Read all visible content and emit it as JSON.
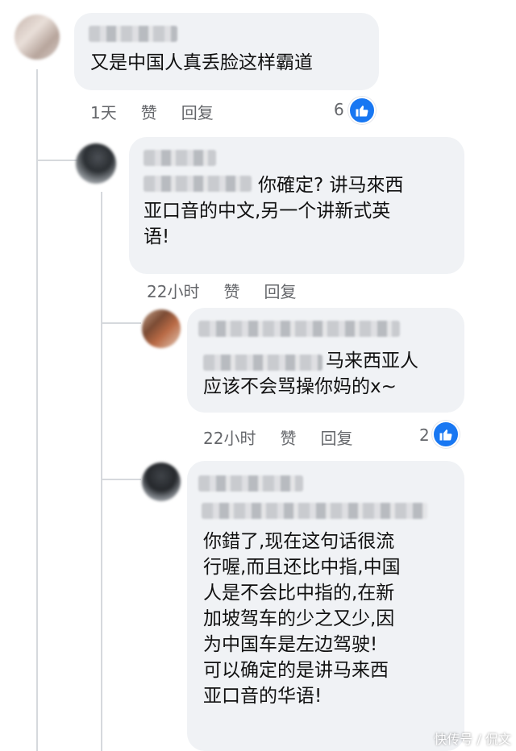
{
  "comments": [
    {
      "text": "又是中国人真丢脸这样霸道",
      "actions": {
        "time": "1天",
        "like": "赞",
        "reply": "回复"
      },
      "likes": "6"
    },
    {
      "text": "你確定? 讲马來西\n亚口音的中文,另一个讲新式英\n语!",
      "actions": {
        "time": "22小时",
        "like": "赞",
        "reply": "回复"
      }
    },
    {
      "text": "马来西亚人\n应该不会骂操你妈的x~",
      "actions": {
        "time": "22小时",
        "like": "赞",
        "reply": "回复"
      },
      "likes": "2"
    },
    {
      "text": "你錯了,现在这句话很流\n行喔,而且还比中指,中国\n人是不会比中指的,在新\n加坡驾车的少之又少,因\n为中国车是左边驾驶!\n可以确定的是讲马来西\n亚口音的华语!"
    }
  ],
  "watermark": "快传号 / 侃文",
  "colors": {
    "bubble": "#f0f2f5",
    "meta": "#65676b",
    "like_blue": "#1877f2"
  },
  "icons": {
    "like": "thumbs-up-icon"
  }
}
